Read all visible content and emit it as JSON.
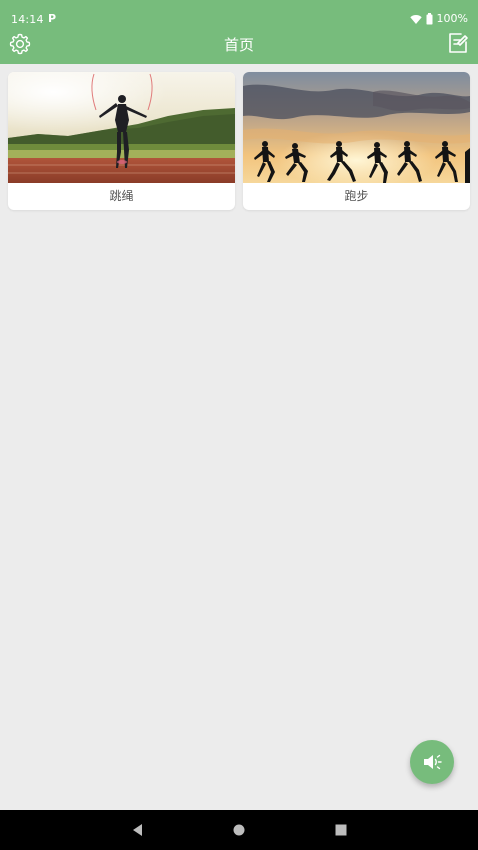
{
  "status_bar": {
    "time": "14:14",
    "notification_icon": "P",
    "battery": "100%"
  },
  "app_bar": {
    "title": "首页",
    "left_icon": "settings-gear-icon",
    "right_icon": "edit-note-icon"
  },
  "cards": [
    {
      "label": "跳绳",
      "image": "jump-rope-photo"
    },
    {
      "label": "跑步",
      "image": "running-silhouettes-photo"
    }
  ],
  "fab": {
    "icon": "speaker-icon"
  },
  "nav_bar": {
    "icons": [
      "back-icon",
      "home-icon",
      "recents-icon"
    ]
  },
  "colors": {
    "primary": "#77bc7c",
    "background": "#ececec",
    "card": "#ffffff",
    "nav_bar": "#000000"
  }
}
